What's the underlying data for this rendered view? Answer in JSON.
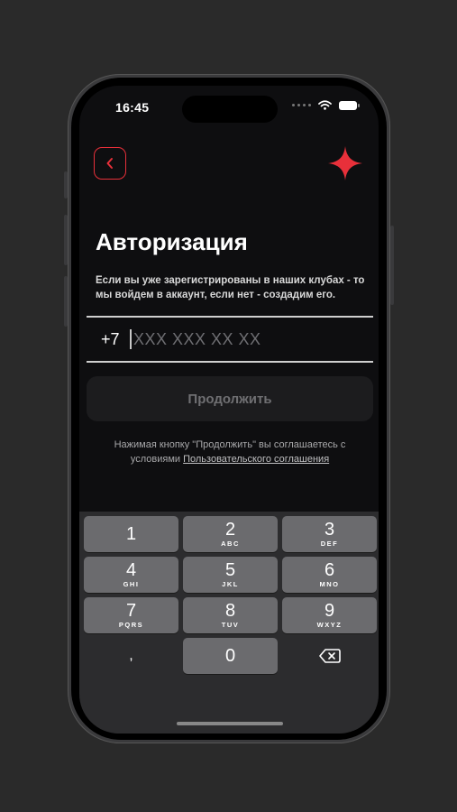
{
  "status": {
    "time": "16:45"
  },
  "header": {
    "back_icon": "chevron-left-icon",
    "logo_icon": "star-icon",
    "accent": "#e8303a"
  },
  "auth": {
    "title": "Авторизация",
    "description": "Если вы уже зарегистрированы в наших клубах - то мы войдем в аккаунт, если нет - создадим его.",
    "phone_prefix": "+7",
    "phone_placeholder": "XXX XXX XX XX",
    "continue_label": "Продолжить",
    "terms_text": "Нажимая кнопку \"Продолжить\" вы соглашаетесь с условиями",
    "terms_link": "Пользовательского соглашения"
  },
  "keyboard": {
    "keys": [
      {
        "digit": "1",
        "letters": ""
      },
      {
        "digit": "2",
        "letters": "ABC"
      },
      {
        "digit": "3",
        "letters": "DEF"
      },
      {
        "digit": "4",
        "letters": "GHI"
      },
      {
        "digit": "5",
        "letters": "JKL"
      },
      {
        "digit": "6",
        "letters": "MNO"
      },
      {
        "digit": "7",
        "letters": "PQRS"
      },
      {
        "digit": "8",
        "letters": "TUV"
      },
      {
        "digit": "9",
        "letters": "WXYZ"
      },
      {
        "digit": ",",
        "letters": ""
      },
      {
        "digit": "0",
        "letters": ""
      },
      {
        "digit": "",
        "letters": ""
      }
    ],
    "delete_icon": "backspace-icon"
  }
}
